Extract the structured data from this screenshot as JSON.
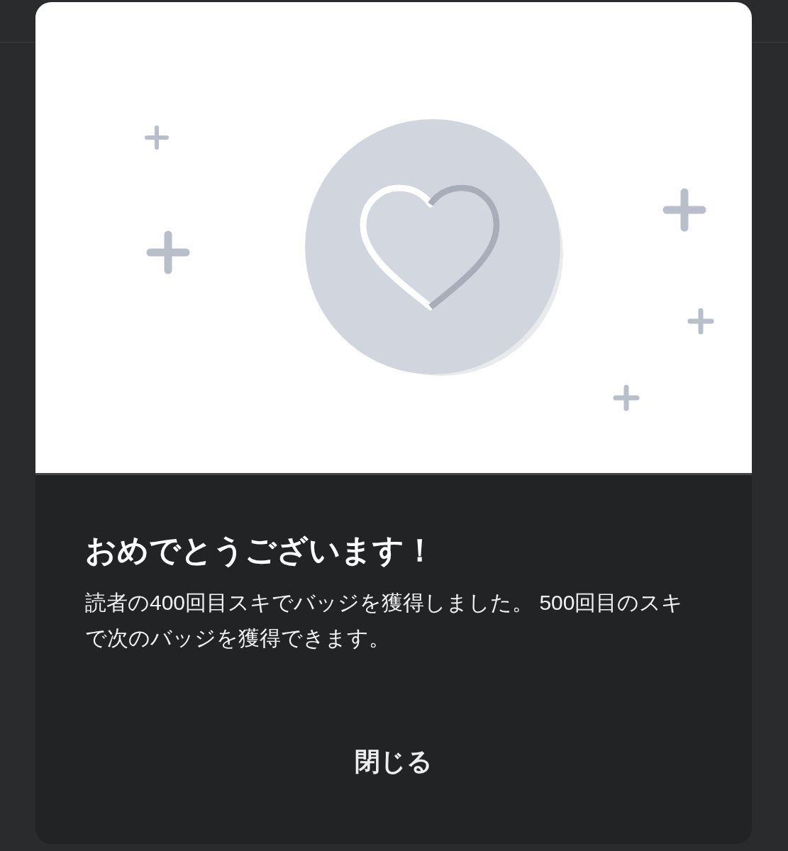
{
  "dialog": {
    "title": "おめでとうございます！",
    "message": "読者の400回目スキでバッジを獲得しました。 500回目のスキで次のバッジを獲得できます。",
    "close_button": "閉じる"
  }
}
